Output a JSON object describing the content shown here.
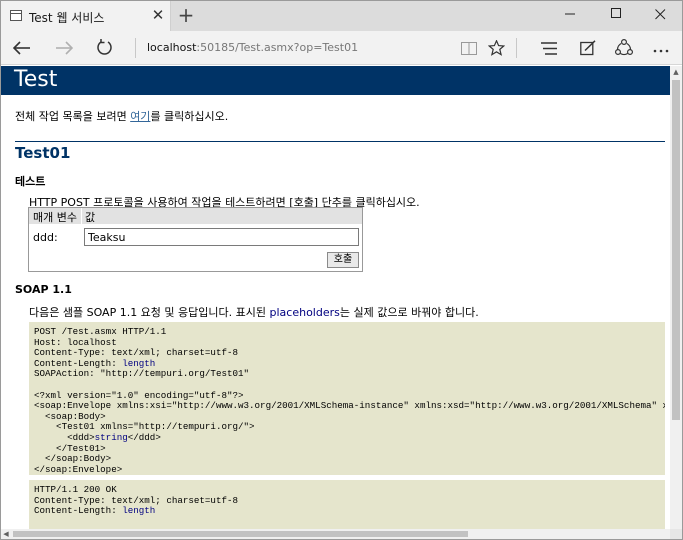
{
  "browser": {
    "tab_title": "Test 웹 서비스",
    "tab_close": "✕",
    "new_tab": "+",
    "url_host": "localhost",
    "url_path": ":50185/Test.asmx?op=Test01"
  },
  "page": {
    "banner_title": "Test",
    "intro_before": "전체 작업 목록을 보려면 ",
    "intro_link": "여기",
    "intro_after": "를 클릭하십시오.",
    "operation_title": "Test01",
    "test_heading": "테스트",
    "test_description": "HTTP POST 프로토콜을 사용하여 작업을 테스트하려면 [호출] 단추를 클릭하십시오.",
    "form": {
      "col_param": "매개 변수",
      "col_value": "값",
      "param_label": "ddd:",
      "param_value": "Teaksu",
      "invoke_label": "호출"
    },
    "soap_heading": "SOAP 1.1",
    "soap_desc_before": "다음은 샘플 SOAP 1.1 요청 및 응답입니다. 표시된 ",
    "soap_desc_placeholder": "placeholders",
    "soap_desc_after": "는 실제 값으로 바꿔야 합니다.",
    "request": {
      "line1": "POST /Test.asmx HTTP/1.1",
      "line2": "Host: localhost",
      "line3": "Content-Type: text/xml; charset=utf-8",
      "line4_prefix": "Content-Length: ",
      "line4_value": "length",
      "line5": "SOAPAction: \"http://tempuri.org/Test01\"",
      "line6": "<?xml version=\"1.0\" encoding=\"utf-8\"?>",
      "line7": "<soap:Envelope xmlns:xsi=\"http://www.w3.org/2001/XMLSchema-instance\" xmlns:xsd=\"http://www.w3.org/2001/XMLSchema\" xmlns:soap=\"http://schemas.xmlsoap.org/soap/envelope/\">",
      "line8": "  <soap:Body>",
      "line9": "    <Test01 xmlns=\"http://tempuri.org/\">",
      "line10_prefix": "      <ddd>",
      "line10_value": "string",
      "line10_suffix": "</ddd>",
      "line11": "    </Test01>",
      "line12": "  </soap:Body>",
      "line13": "</soap:Envelope>"
    },
    "response": {
      "line1": "HTTP/1.1 200 OK",
      "line2": "Content-Type: text/xml; charset=utf-8",
      "line3_prefix": "Content-Length: ",
      "line3_value": "length"
    }
  }
}
